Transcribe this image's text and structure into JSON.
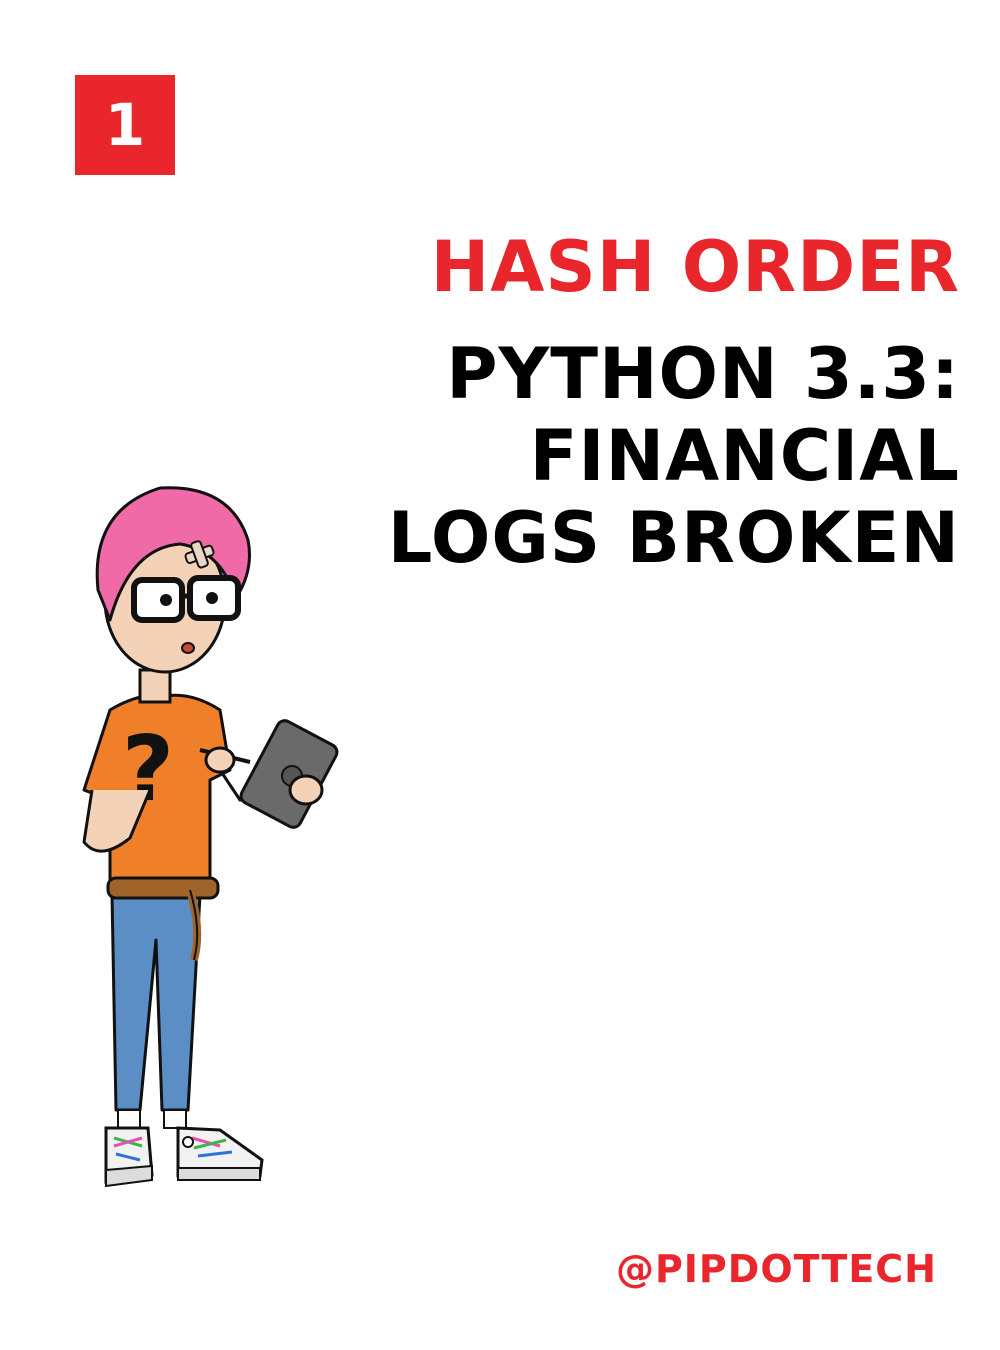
{
  "badge": {
    "number": "1",
    "color": "#e8262b"
  },
  "title": {
    "kicker": "HASH ORDER",
    "lines": [
      "PYTHON 3.3:",
      "FINANCIAL",
      "LOGS BROKEN"
    ]
  },
  "footer": {
    "handle": "@PIPDOTTECH"
  },
  "colors": {
    "accent": "#e8262b",
    "text": "#000000",
    "background": "#ffffff",
    "hair": "#f06aa8",
    "shirt": "#f07f2a",
    "jeans": "#5b8ec4"
  },
  "illustration": {
    "subject": "character-illustration",
    "shirt_symbol": "?"
  }
}
